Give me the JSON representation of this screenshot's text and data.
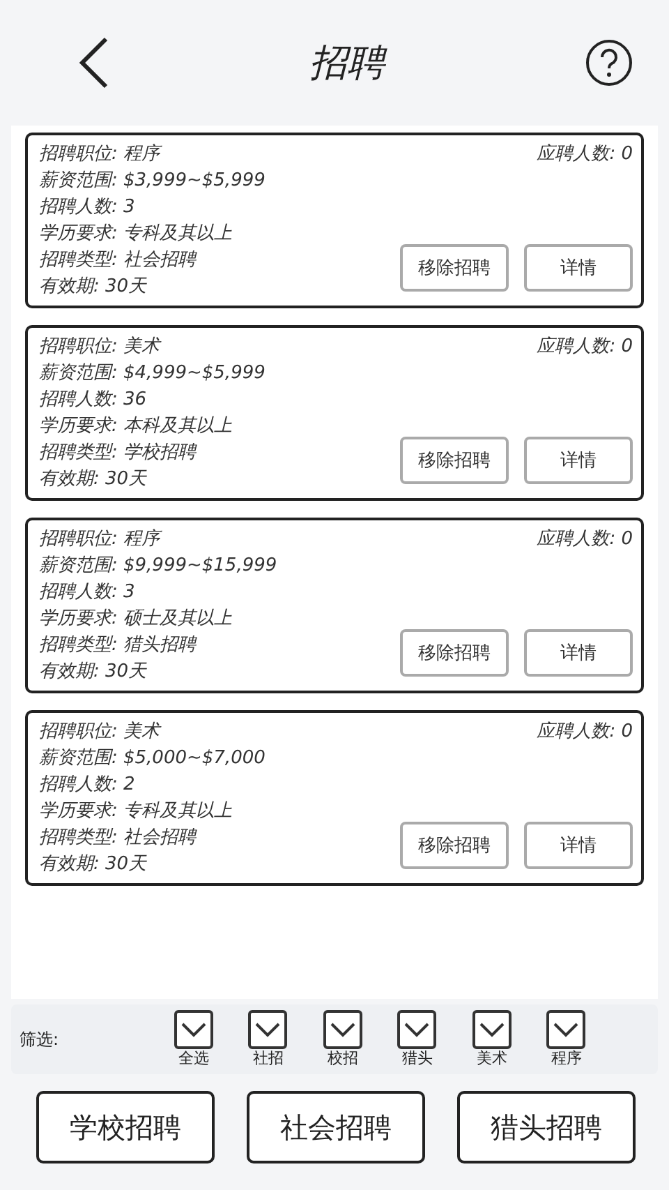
{
  "header": {
    "title": "招聘"
  },
  "postings": [
    {
      "lines": [
        "招聘职位: 程序",
        "薪资范围: $3,999~$5,999",
        "招聘人数: 3",
        "学历要求: 专科及其以上",
        "招聘类型: 社会招聘",
        "有效期: 30天"
      ],
      "applicants": "应聘人数: 0",
      "buttons": [
        "移除招聘",
        "详情"
      ]
    },
    {
      "lines": [
        "招聘职位: 美术",
        "薪资范围: $4,999~$5,999",
        "招聘人数: 36",
        "学历要求: 本科及其以上",
        "招聘类型: 学校招聘",
        "有效期: 30天"
      ],
      "applicants": "应聘人数: 0",
      "buttons": [
        "移除招聘",
        "详情"
      ]
    },
    {
      "lines": [
        "招聘职位: 程序",
        "薪资范围: $9,999~$15,999",
        "招聘人数: 3",
        "学历要求: 硕士及其以上",
        "招聘类型: 猎头招聘",
        "有效期: 30天"
      ],
      "applicants": "应聘人数: 0",
      "buttons": [
        "移除招聘",
        "详情"
      ]
    },
    {
      "lines": [
        "招聘职位: 美术",
        "薪资范围: $5,000~$7,000",
        "招聘人数: 2",
        "学历要求: 专科及其以上",
        "招聘类型: 社会招聘",
        "有效期: 30天"
      ],
      "applicants": "应聘人数: 0",
      "buttons": [
        "移除招聘",
        "详情"
      ]
    }
  ],
  "filter": {
    "label": "筛选:",
    "options": [
      {
        "label": "全选",
        "checked": true
      },
      {
        "label": "社招",
        "checked": true
      },
      {
        "label": "校招",
        "checked": true
      },
      {
        "label": "猎头",
        "checked": true
      },
      {
        "label": "美术",
        "checked": true
      },
      {
        "label": "程序",
        "checked": true
      }
    ]
  },
  "actions": [
    "学校招聘",
    "社会招聘",
    "猎头招聘"
  ]
}
